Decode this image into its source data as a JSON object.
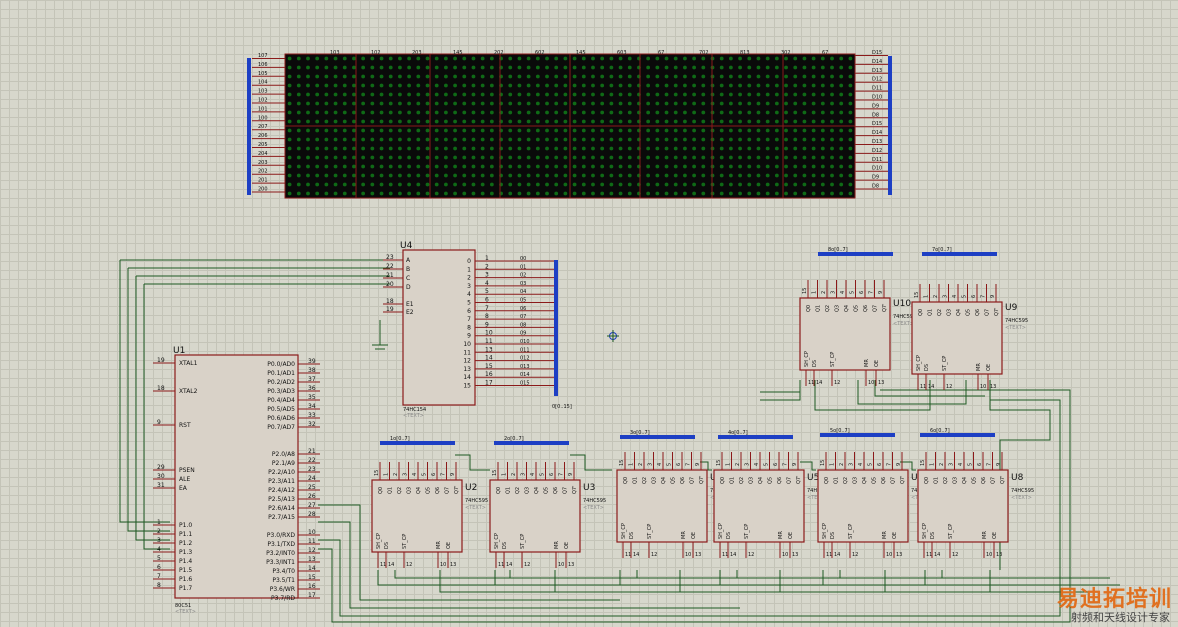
{
  "led_matrix": {
    "left_labels": [
      "107",
      "106",
      "105",
      "104",
      "103",
      "102",
      "101",
      "100",
      "207",
      "206",
      "205",
      "204",
      "203",
      "202",
      "201",
      "200"
    ],
    "right_labels": [
      "D15",
      "D14",
      "D13",
      "D12",
      "D11",
      "D10",
      "D9",
      "D8",
      "D15",
      "D14",
      "D13",
      "D12",
      "D11",
      "D10",
      "D9",
      "D8"
    ],
    "top_labels": [
      "103",
      "102",
      "203",
      "145",
      "202",
      "602",
      "145",
      "603",
      "67",
      "702",
      "813",
      "302",
      "67"
    ]
  },
  "u4": {
    "ref": "U4",
    "part": "74HC154",
    "text": "<TEXT>",
    "inputs": [
      {
        "num": "23",
        "name": "A"
      },
      {
        "num": "22",
        "name": "B"
      },
      {
        "num": "21",
        "name": "C"
      },
      {
        "num": "20",
        "name": "D"
      },
      {
        "num": "18",
        "name": "E1"
      },
      {
        "num": "19",
        "name": "E2"
      }
    ],
    "outputs": [
      "0",
      "1",
      "2",
      "3",
      "4",
      "5",
      "6",
      "7",
      "8",
      "9",
      "10",
      "11",
      "12",
      "13",
      "14",
      "15"
    ],
    "out_pins": [
      "1",
      "2",
      "3",
      "4",
      "5",
      "6",
      "7",
      "8",
      "9",
      "10",
      "11",
      "13",
      "14",
      "15",
      "16",
      "17"
    ],
    "nets": [
      "00",
      "01",
      "02",
      "03",
      "04",
      "05",
      "06",
      "07",
      "08",
      "09",
      "010",
      "011",
      "012",
      "013",
      "014",
      "015"
    ],
    "bus_label": "0[0..15]"
  },
  "u1": {
    "ref": "U1",
    "part": "80C51",
    "text": "<TEXT>",
    "left": [
      {
        "num": "19",
        "name": "XTAL1"
      },
      {
        "num": "18",
        "name": "XTAL2"
      },
      {
        "num": "9",
        "name": "RST"
      },
      {
        "num": "29",
        "name": "PSEN"
      },
      {
        "num": "30",
        "name": "ALE"
      },
      {
        "num": "31",
        "name": "EA"
      },
      {
        "num": "1",
        "name": "P1.0"
      },
      {
        "num": "2",
        "name": "P1.1"
      },
      {
        "num": "3",
        "name": "P1.2"
      },
      {
        "num": "4",
        "name": "P1.3"
      },
      {
        "num": "5",
        "name": "P1.4"
      },
      {
        "num": "6",
        "name": "P1.5"
      },
      {
        "num": "7",
        "name": "P1.6"
      },
      {
        "num": "8",
        "name": "P1.7"
      }
    ],
    "right": [
      {
        "num": "39",
        "name": "P0.0/AD0"
      },
      {
        "num": "38",
        "name": "P0.1/AD1"
      },
      {
        "num": "37",
        "name": "P0.2/AD2"
      },
      {
        "num": "36",
        "name": "P0.3/AD3"
      },
      {
        "num": "35",
        "name": "P0.4/AD4"
      },
      {
        "num": "34",
        "name": "P0.5/AD5"
      },
      {
        "num": "33",
        "name": "P0.6/AD6"
      },
      {
        "num": "32",
        "name": "P0.7/AD7"
      },
      {
        "num": "21",
        "name": "P2.0/A8"
      },
      {
        "num": "22",
        "name": "P2.1/A9"
      },
      {
        "num": "23",
        "name": "P2.2/A10"
      },
      {
        "num": "24",
        "name": "P2.3/A11"
      },
      {
        "num": "25",
        "name": "P2.4/A12"
      },
      {
        "num": "26",
        "name": "P2.5/A13"
      },
      {
        "num": "27",
        "name": "P2.6/A14"
      },
      {
        "num": "28",
        "name": "P2.7/A15"
      },
      {
        "num": "10",
        "name": "P3.0/RXD"
      },
      {
        "num": "11",
        "name": "P3.1/TXD"
      },
      {
        "num": "12",
        "name": "P3.2/INT0"
      },
      {
        "num": "13",
        "name": "P3.3/INT1"
      },
      {
        "num": "14",
        "name": "P3.4/T0"
      },
      {
        "num": "15",
        "name": "P3.5/T1"
      },
      {
        "num": "16",
        "name": "P3.6/WR"
      },
      {
        "num": "17",
        "name": "P3.7/RD"
      }
    ]
  },
  "shift_regs": [
    {
      "ref": "U2",
      "part": "74HC595",
      "bus": "1o[0..7]"
    },
    {
      "ref": "U3",
      "part": "74HC595",
      "bus": "2o[0..7]"
    },
    {
      "ref": "U4",
      "part": "74HC595",
      "bus": "3o[0..7]"
    },
    {
      "ref": "U5",
      "part": "74HC595",
      "bus": "4o[0..7]"
    },
    {
      "ref": "U6",
      "part": "74HC595",
      "bus": "5o[0..7]"
    },
    {
      "ref": "U8",
      "part": "74HC595",
      "bus": "6o[0..7]"
    },
    {
      "ref": "U10",
      "part": "74HC595",
      "bus": "8o[0..7]"
    },
    {
      "ref": "U9",
      "part": "74HC595",
      "bus": "7o[0..7]"
    }
  ],
  "sr_pins": {
    "q": [
      "Q0",
      "Q1",
      "Q2",
      "Q3",
      "Q4",
      "Q5",
      "Q6",
      "Q7",
      "Q7'"
    ],
    "q_nums": [
      "15",
      "1",
      "2",
      "3",
      "4",
      "5",
      "6",
      "7",
      "9"
    ],
    "bottom": [
      "SH_CP",
      "DS",
      "ST_CP",
      "MR",
      "OE"
    ],
    "bottom_nums": [
      "11",
      "14",
      "12",
      "10",
      "13"
    ]
  },
  "text_placeholder": "<TEXT>",
  "watermark": {
    "main": "易迪拓培训",
    "sub": "射频和天线设计专家"
  },
  "colors": {
    "grid_bg": "#d7d7cc",
    "chip_border": "#8b1a1a",
    "bus": "#1d3fc4",
    "wire": "#1d5a22",
    "led_off": "#0f6a16",
    "matrix_bg": "#0a0a0a"
  }
}
